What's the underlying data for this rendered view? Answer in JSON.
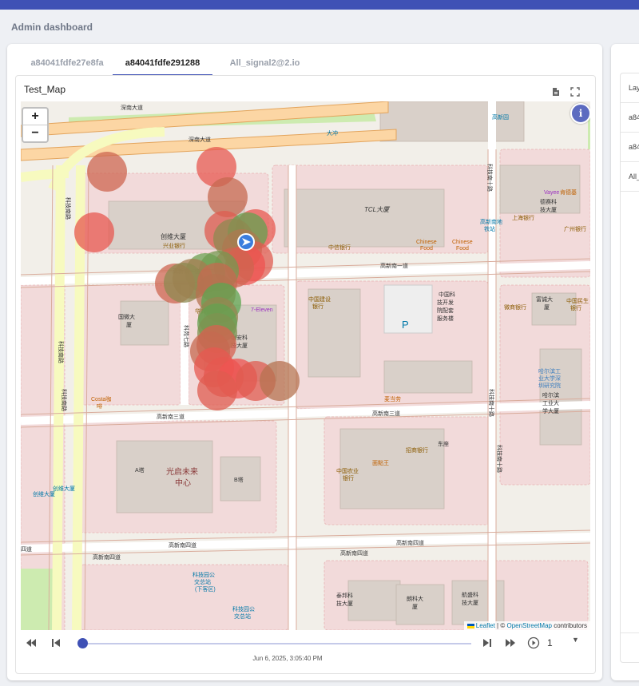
{
  "page": {
    "title": "Admin dashboard"
  },
  "tabs": [
    {
      "label": "a84041fdfe27e8fa",
      "active": false
    },
    {
      "label": "a84041fdfe291288",
      "active": true
    },
    {
      "label": "All_signal2@2.io",
      "active": false
    }
  ],
  "map_panel": {
    "title": "Test_Map",
    "zoom_in": "+",
    "zoom_out": "−",
    "info_button": "i",
    "attribution": {
      "leaflet": "Leaflet",
      "separator": "| ©",
      "osm": "OpenStreetMap",
      "suffix": "contributors"
    },
    "map_labels": {
      "roads": [
        "深南大道",
        "深南大道",
        "高新南一道",
        "高新南三道",
        "高新南四道",
        "高新南四道",
        "高新南四道",
        "科技南路",
        "科技南路",
        "科技南十路",
        "科技南十路",
        "科技南十路",
        "科苑路"
      ],
      "places": [
        "TCL大厦",
        "创维大厦",
        "兴业银行",
        "中信银行",
        "Chinese Food",
        "Chinese Food",
        "德赛科技大厦",
        "Vayee",
        "肯德基",
        "上海银行",
        "广州银行",
        "华商银行",
        "7-Eleven",
        "国微大厦",
        "联想大厦",
        "银安科技大厦",
        "中国建设银行",
        "中国科技开发院配套服务楼",
        "P",
        "微商银行",
        "富诚大厦",
        "中国民生银行",
        "哈尔滨工业大学深圳研究院",
        "哈尔滨工业大学",
        "Costa咖啡",
        "光启未来中心",
        "A塔",
        "B塔",
        "中国农业银行",
        "招商银行",
        "东座",
        "面點王",
        "麦当劳",
        "创维大厦",
        "科技园公交总站(下客区)",
        "科技园公交总站",
        "泰邦科技大厦",
        "朗科大厦",
        "航盛科技大厦",
        "高新园",
        "大冲"
      ]
    }
  },
  "signal_points": [
    {
      "lat": 22.54212,
      "lon": 113.94408,
      "strength": 0.2
    },
    {
      "lat": 22.54218,
      "lon": 113.94545,
      "strength": 0.05
    },
    {
      "lat": 22.5418,
      "lon": 113.94559,
      "strength": 0.25
    },
    {
      "lat": 22.54136,
      "lon": 113.94392,
      "strength": 0.05
    },
    {
      "lat": 22.54138,
      "lon": 113.94555,
      "strength": 0.1
    },
    {
      "lat": 22.5414,
      "lon": 113.94594,
      "strength": 0.05
    },
    {
      "lat": 22.54136,
      "lon": 113.94584,
      "strength": 0.85
    },
    {
      "lat": 22.54128,
      "lon": 113.94566,
      "strength": 0.6
    },
    {
      "lat": 22.54115,
      "lon": 113.94577,
      "strength": 0.4
    },
    {
      "lat": 22.541,
      "lon": 113.94591,
      "strength": 0.1
    },
    {
      "lat": 22.54095,
      "lon": 113.94581,
      "strength": 0.0
    },
    {
      "lat": 22.54092,
      "lon": 113.94567,
      "strength": 0.2
    },
    {
      "lat": 22.54088,
      "lon": 113.94548,
      "strength": 0.75
    },
    {
      "lat": 22.54085,
      "lon": 113.94531,
      "strength": 0.8
    },
    {
      "lat": 22.54078,
      "lon": 113.94515,
      "strength": 0.45
    },
    {
      "lat": 22.54072,
      "lon": 113.94493,
      "strength": 0.2
    },
    {
      "lat": 22.54073,
      "lon": 113.94504,
      "strength": 0.6
    },
    {
      "lat": 22.54073,
      "lon": 113.94546,
      "strength": 0.25
    },
    {
      "lat": 22.54059,
      "lon": 113.94544,
      "strength": 0.35
    },
    {
      "lat": 22.54048,
      "lon": 113.94551,
      "strength": 0.9
    },
    {
      "lat": 22.5403,
      "lon": 113.94547,
      "strength": 0.55
    },
    {
      "lat": 22.54022,
      "lon": 113.94546,
      "strength": 0.85
    },
    {
      "lat": 22.5401,
      "lon": 113.94546,
      "strength": 0.7
    },
    {
      "lat": 22.53995,
      "lon": 113.94545,
      "strength": 0.15
    },
    {
      "lat": 22.53987,
      "lon": 113.94537,
      "strength": 0.25
    },
    {
      "lat": 22.53967,
      "lon": 113.94542,
      "strength": 0.05
    },
    {
      "lat": 22.53955,
      "lon": 113.94554,
      "strength": 0.05
    },
    {
      "lat": 22.53953,
      "lon": 113.94571,
      "strength": 0.0
    },
    {
      "lat": 22.5395,
      "lon": 113.94594,
      "strength": 0.1
    },
    {
      "lat": 22.5395,
      "lon": 113.94624,
      "strength": 0.35
    },
    {
      "lat": 22.53938,
      "lon": 113.94546,
      "strength": 0.1
    }
  ],
  "direction_marker": {
    "lat": 22.54124,
    "lon": 113.94582,
    "icon": "navigation-arrow-icon"
  },
  "signal_colors": {
    "weak": "#ef5350",
    "strong": "#4caf50"
  },
  "playback": {
    "rewind_icon": "fast-rewind-icon",
    "prev_icon": "skip-previous-icon",
    "next_icon": "skip-next-icon",
    "forward_icon": "fast-forward-icon",
    "play_icon": "play-circle-icon",
    "speed": "1",
    "position": 0.0,
    "timestamp": "Jun 6, 2025, 3:05:40 PM"
  },
  "side_panel": {
    "header": "Lay",
    "rows": [
      "a84",
      "a84",
      "All_"
    ]
  },
  "colors": {
    "accent": "#3f51b5",
    "background": "#eef0f4"
  }
}
